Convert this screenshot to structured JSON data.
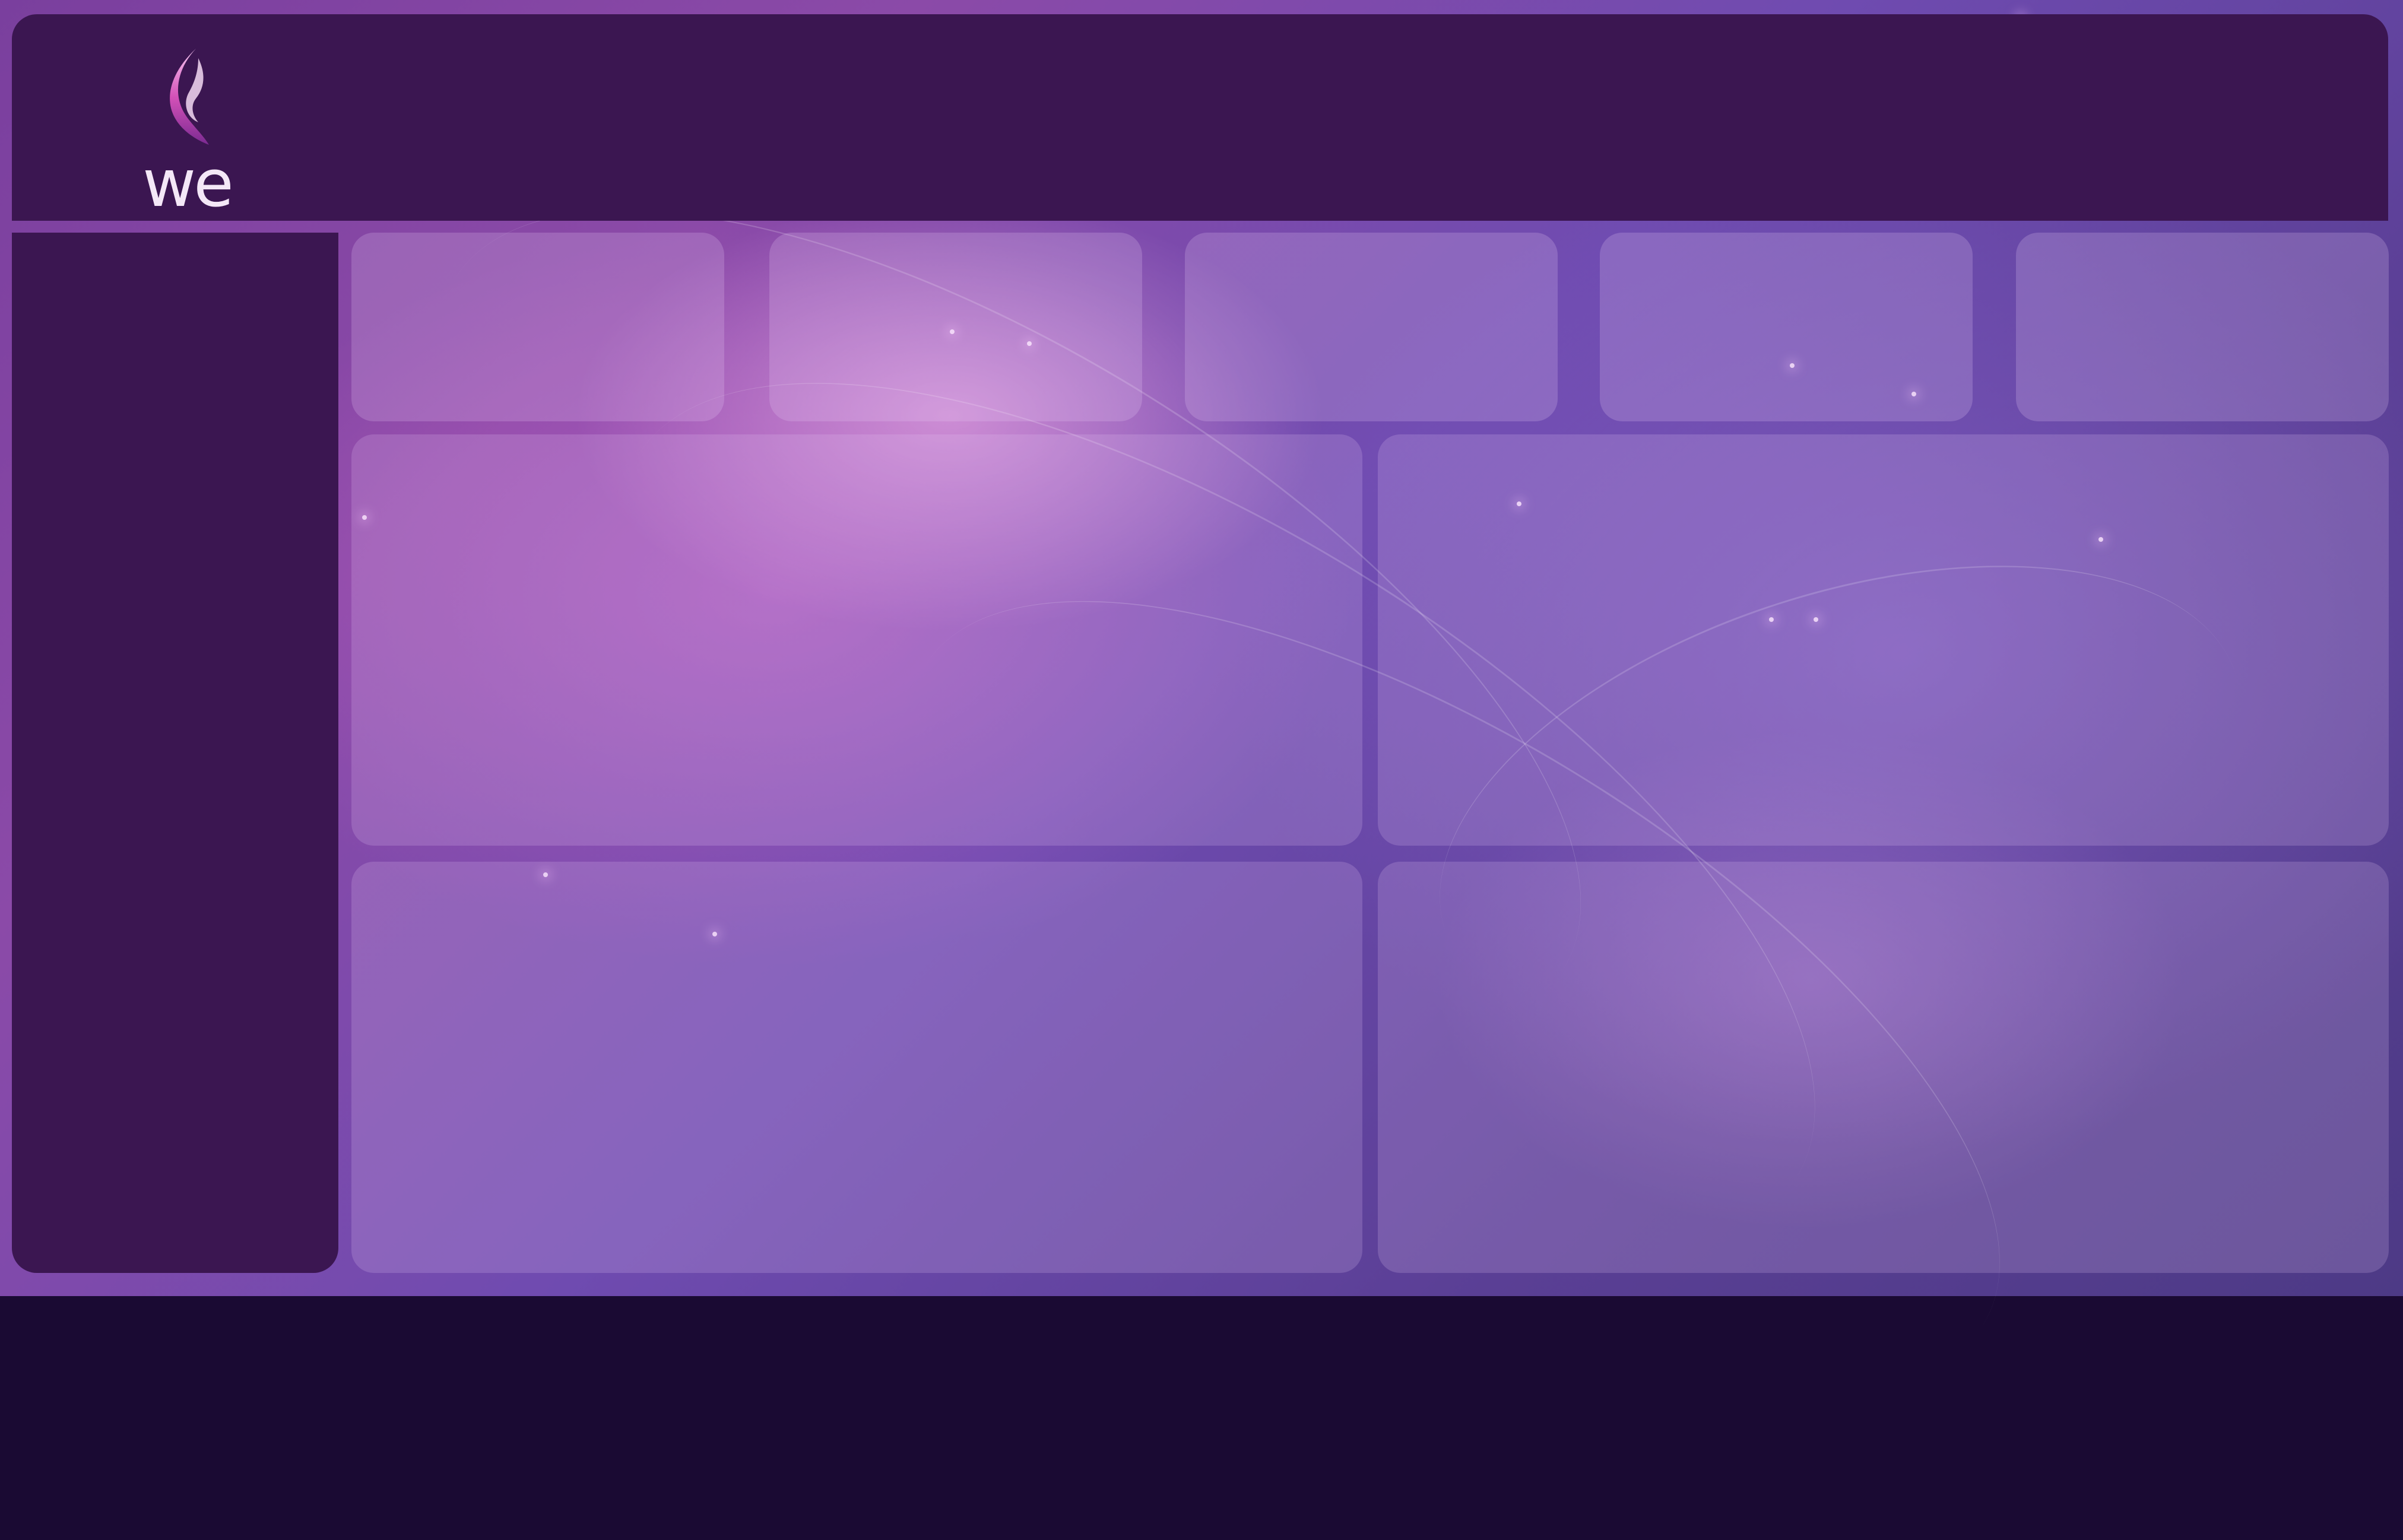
{
  "brand": {
    "logo_text": "we",
    "logo_icon": "we-flame-logo-icon"
  },
  "colors": {
    "panel": "#3b1651",
    "background_dark": "#1a0a33",
    "accent_pink": "#c85ab8",
    "accent_violet": "#6f4bb0"
  },
  "dashboard": {
    "summary_cards": [
      {},
      {},
      {},
      {},
      {}
    ],
    "widgets": [
      {},
      {},
      {},
      {}
    ]
  }
}
